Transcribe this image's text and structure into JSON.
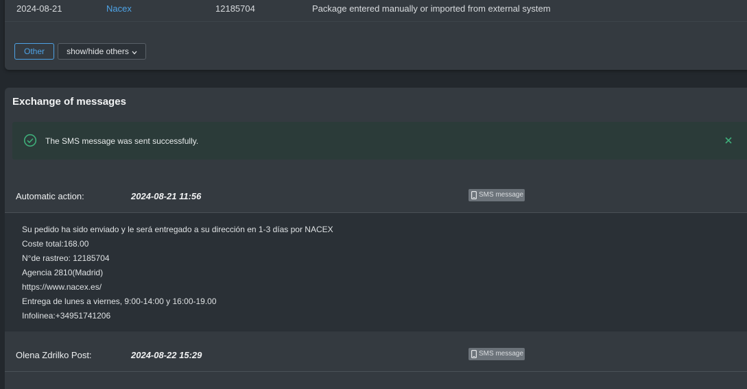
{
  "shipments": {
    "row": {
      "date": "2024-08-21",
      "carrier": "Nacex",
      "tracking": "12185704",
      "description": "Package entered manually or imported from external system"
    },
    "filter_other": "Other",
    "toggle_label": "show/hide others"
  },
  "messages": {
    "title": "Exchange of messages",
    "alert_text": "The SMS message was sent successfully.",
    "items": [
      {
        "author": "Automatic action:",
        "time": "2024-08-21 11:56",
        "type": "SMS message",
        "lines": [
          "Su pedido ha sido enviado y le será entregado a su dirección en 1-3 días por NACEX",
          "Coste total:168.00",
          "N°de rastreo: 12185704",
          "Agencia 2810(Madrid)",
          "https://www.nacex.es/",
          "Entrega de lunes a viernes, 9:00-14:00 y 16:00-19.00",
          "Infolinea:+34951741206"
        ]
      },
      {
        "author": "Olena Zdrilko Post:",
        "time": "2024-08-22 15:29",
        "type": "SMS message"
      }
    ]
  },
  "icons": {
    "success": "check-circle-icon",
    "close": "close-icon",
    "phone": "mobile-phone-icon",
    "chevron": "chevron-down-icon"
  },
  "colors": {
    "accent": "#4ea3e6",
    "success": "#3fae7a",
    "background": "#23282d",
    "panel": "#343a40"
  }
}
